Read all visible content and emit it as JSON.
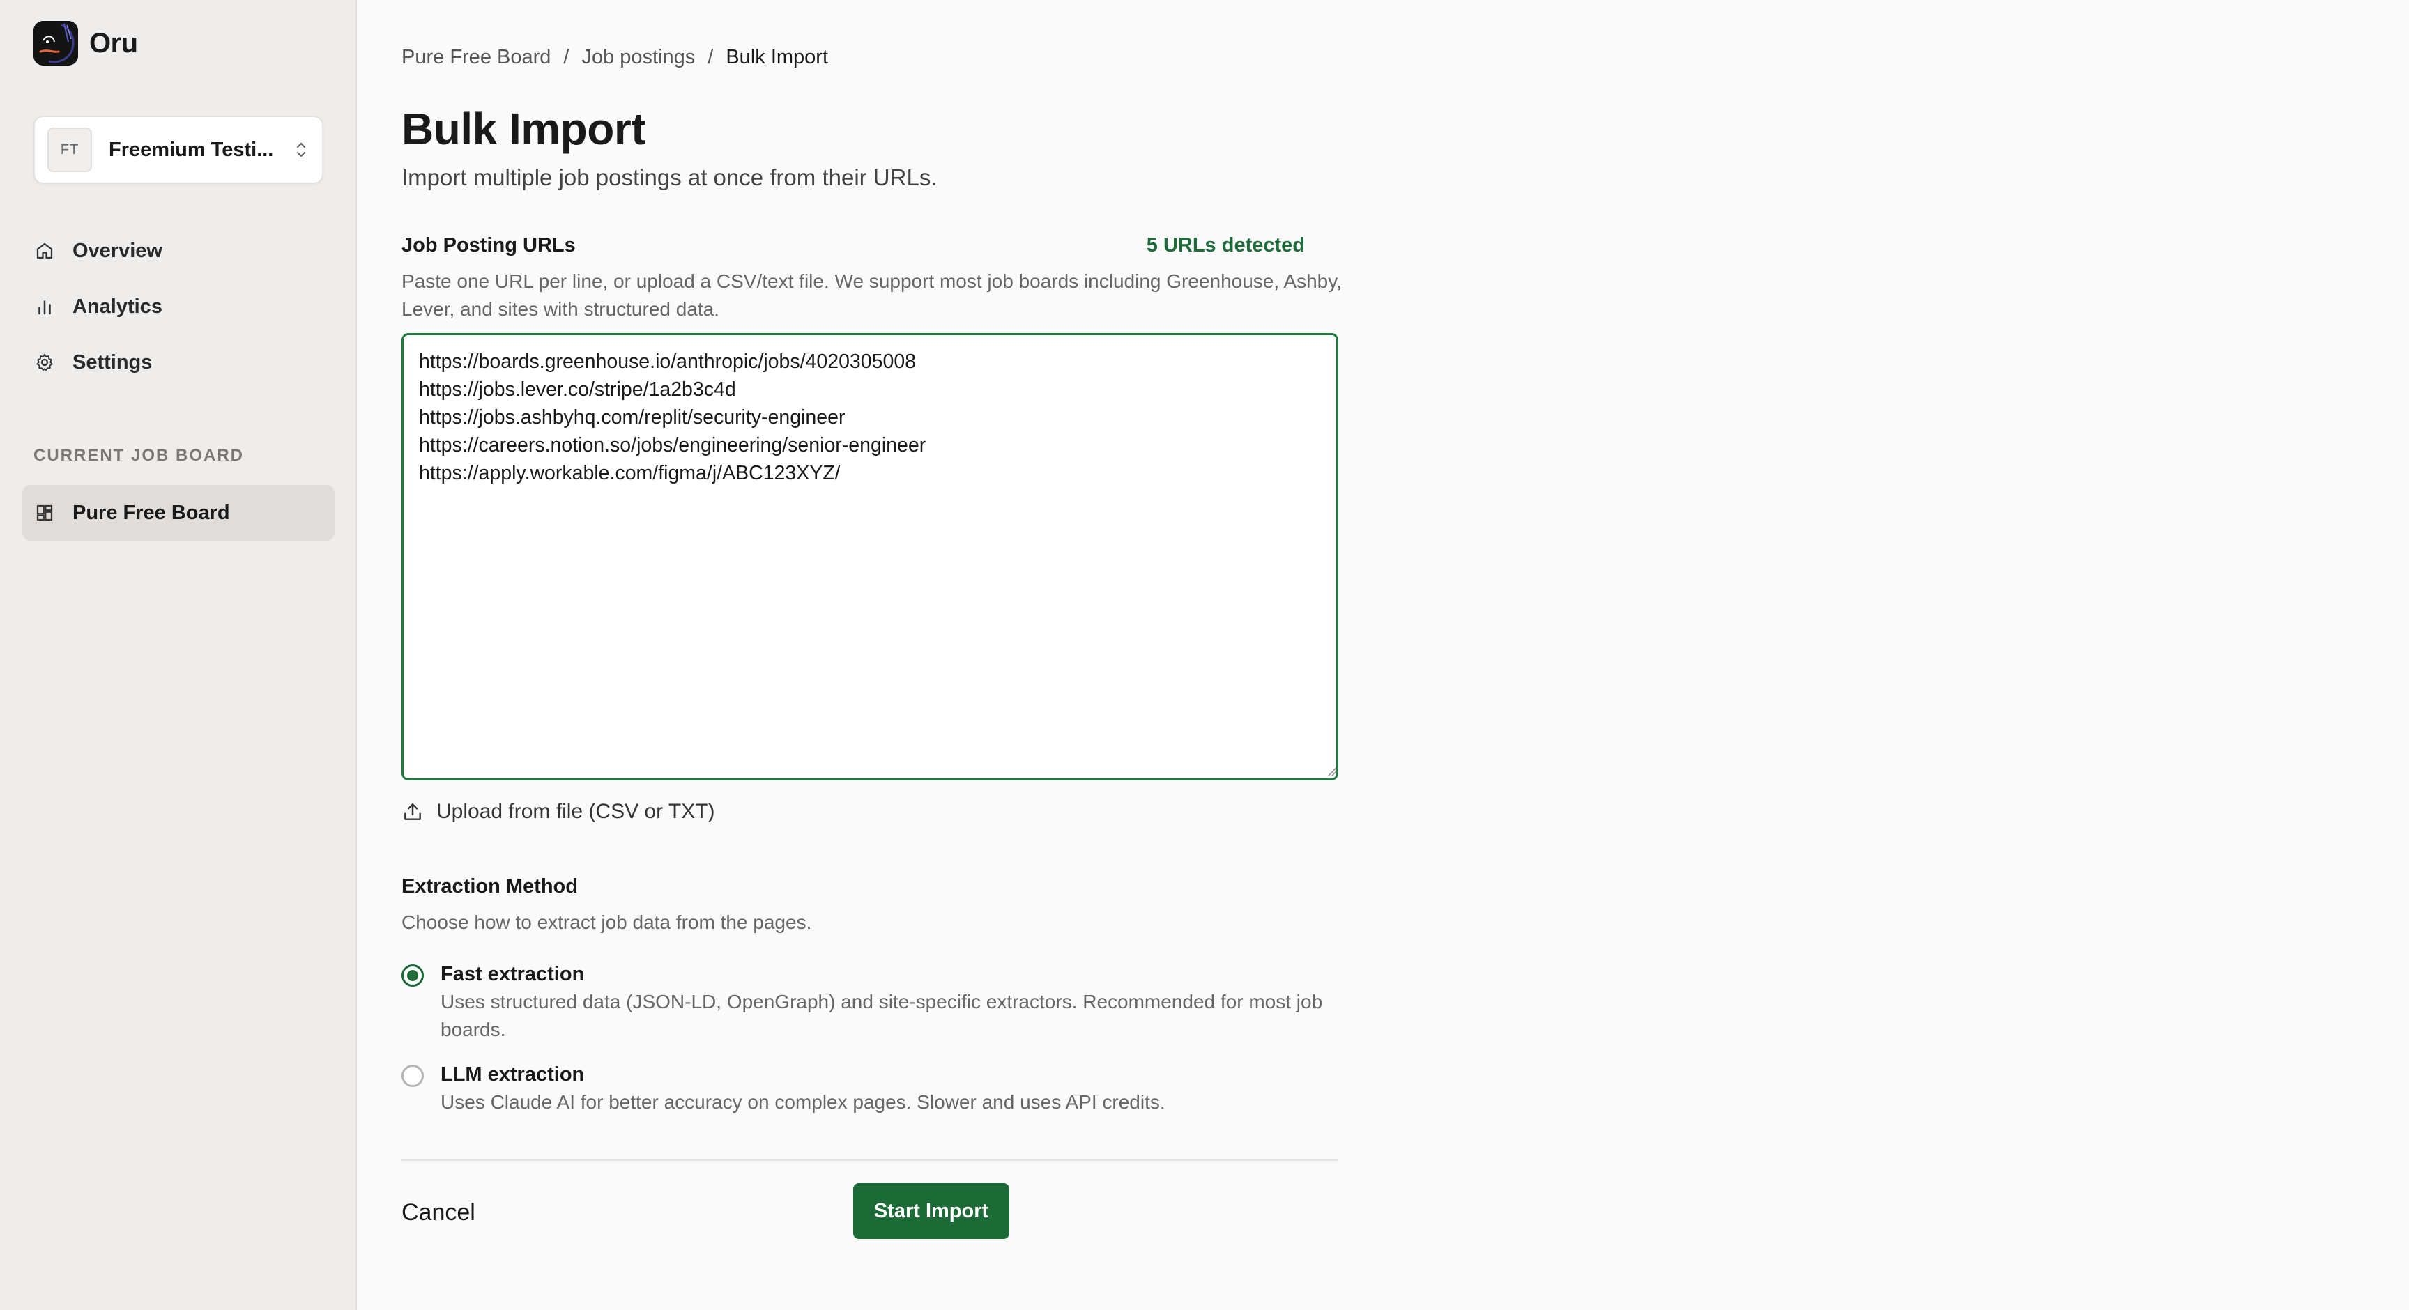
{
  "brand": {
    "name": "Oru",
    "logo_icon": "oru-logo"
  },
  "org_switcher": {
    "initials": "FT",
    "name": "Freemium Testi...",
    "icon": "chevron-up-down-icon"
  },
  "nav": {
    "items": [
      {
        "label": "Overview",
        "icon": "home-icon"
      },
      {
        "label": "Analytics",
        "icon": "bar-chart-icon"
      },
      {
        "label": "Settings",
        "icon": "gear-icon"
      }
    ]
  },
  "current_board": {
    "section_label": "CURRENT JOB BOARD",
    "label": "Pure Free Board",
    "icon": "grid-icon"
  },
  "breadcrumb": {
    "items": [
      "Pure Free Board",
      "Job postings",
      "Bulk Import"
    ],
    "separator": "/"
  },
  "page": {
    "title": "Bulk Import",
    "subtitle": "Import multiple job postings at once from their URLs."
  },
  "urls_field": {
    "label": "Job Posting URLs",
    "count_text": "5 URLs detected",
    "help": "Paste one URL per line, or upload a CSV/text file. We support most job boards including Greenhouse, Ashby, Lever, and sites with structured data.",
    "value": "https://boards.greenhouse.io/anthropic/jobs/4020305008\nhttps://jobs.lever.co/stripe/1a2b3c4d\nhttps://jobs.ashbyhq.com/replit/security-engineer\nhttps://careers.notion.so/jobs/engineering/senior-engineer\nhttps://apply.workable.com/figma/j/ABC123XYZ/"
  },
  "upload": {
    "label": "Upload from file (CSV or TXT)",
    "icon": "upload-icon"
  },
  "extraction": {
    "label": "Extraction Method",
    "help": "Choose how to extract job data from the pages.",
    "selected": "fast",
    "options": [
      {
        "title": "Fast extraction",
        "desc": "Uses structured data (JSON-LD, OpenGraph) and site-specific extractors. Recommended for most job boards."
      },
      {
        "title": "LLM extraction",
        "desc": "Uses Claude AI for better accuracy on complex pages. Slower and uses API credits."
      }
    ]
  },
  "actions": {
    "cancel": "Cancel",
    "start": "Start Import"
  },
  "colors": {
    "accent": "#1c6a36",
    "sidebar_bg": "#efedeb",
    "active_item_bg": "#dfdcd9"
  }
}
